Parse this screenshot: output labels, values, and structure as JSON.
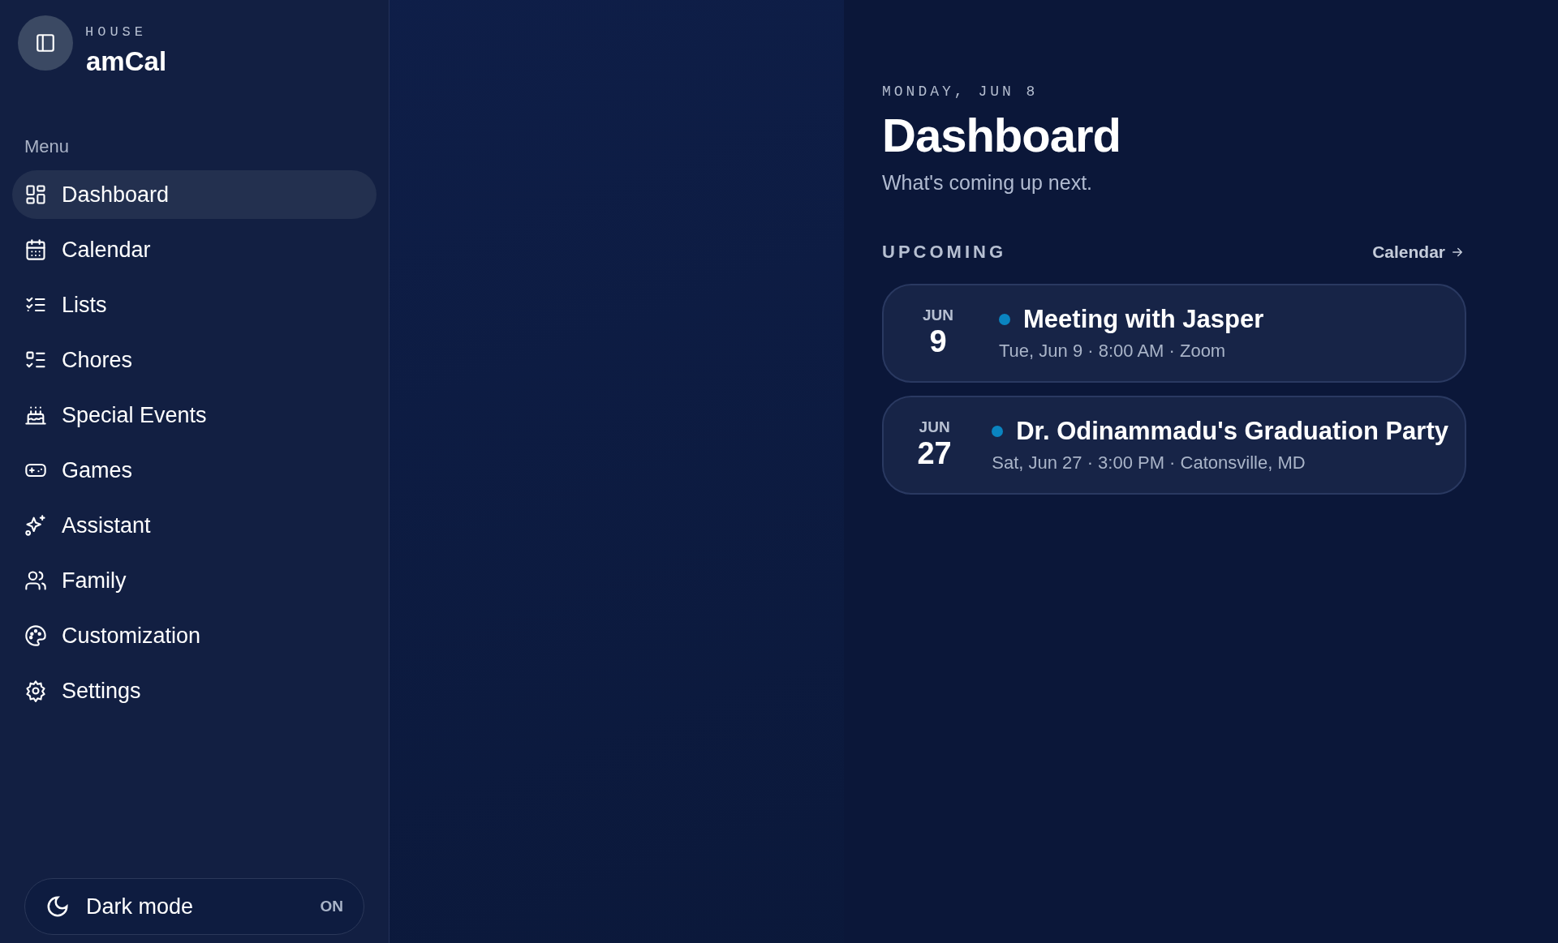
{
  "sidebar": {
    "eyebrow": "HOUSE",
    "app_name": "amCal",
    "menu_label": "Menu",
    "items": [
      {
        "label": "Dashboard",
        "selected": true
      },
      {
        "label": "Calendar",
        "selected": false
      },
      {
        "label": "Lists",
        "selected": false
      },
      {
        "label": "Chores",
        "selected": false
      },
      {
        "label": "Special Events",
        "selected": false
      },
      {
        "label": "Games",
        "selected": false
      },
      {
        "label": "Assistant",
        "selected": false
      },
      {
        "label": "Family",
        "selected": false
      },
      {
        "label": "Customization",
        "selected": false
      },
      {
        "label": "Settings",
        "selected": false
      }
    ],
    "dark_mode": {
      "label": "Dark mode",
      "state": "ON"
    }
  },
  "main": {
    "date": "MONDAY, JUN 8",
    "title": "Dashboard",
    "subtitle": "What's coming up next.",
    "section": {
      "title": "UPCOMING",
      "link": "Calendar",
      "events": [
        {
          "month": "JUN",
          "day": "9",
          "title": "Meeting with Jasper",
          "details": "Tue, Jun 9 · 8:00 AM · Zoom",
          "color": "#0a84c0"
        },
        {
          "month": "JUN",
          "day": "27",
          "title": "Dr. Odinammadu's Graduation Party",
          "details": "Sat, Jun 27 · 3:00 PM · Catonsville, MD",
          "color": "#0a84c0"
        }
      ]
    }
  }
}
